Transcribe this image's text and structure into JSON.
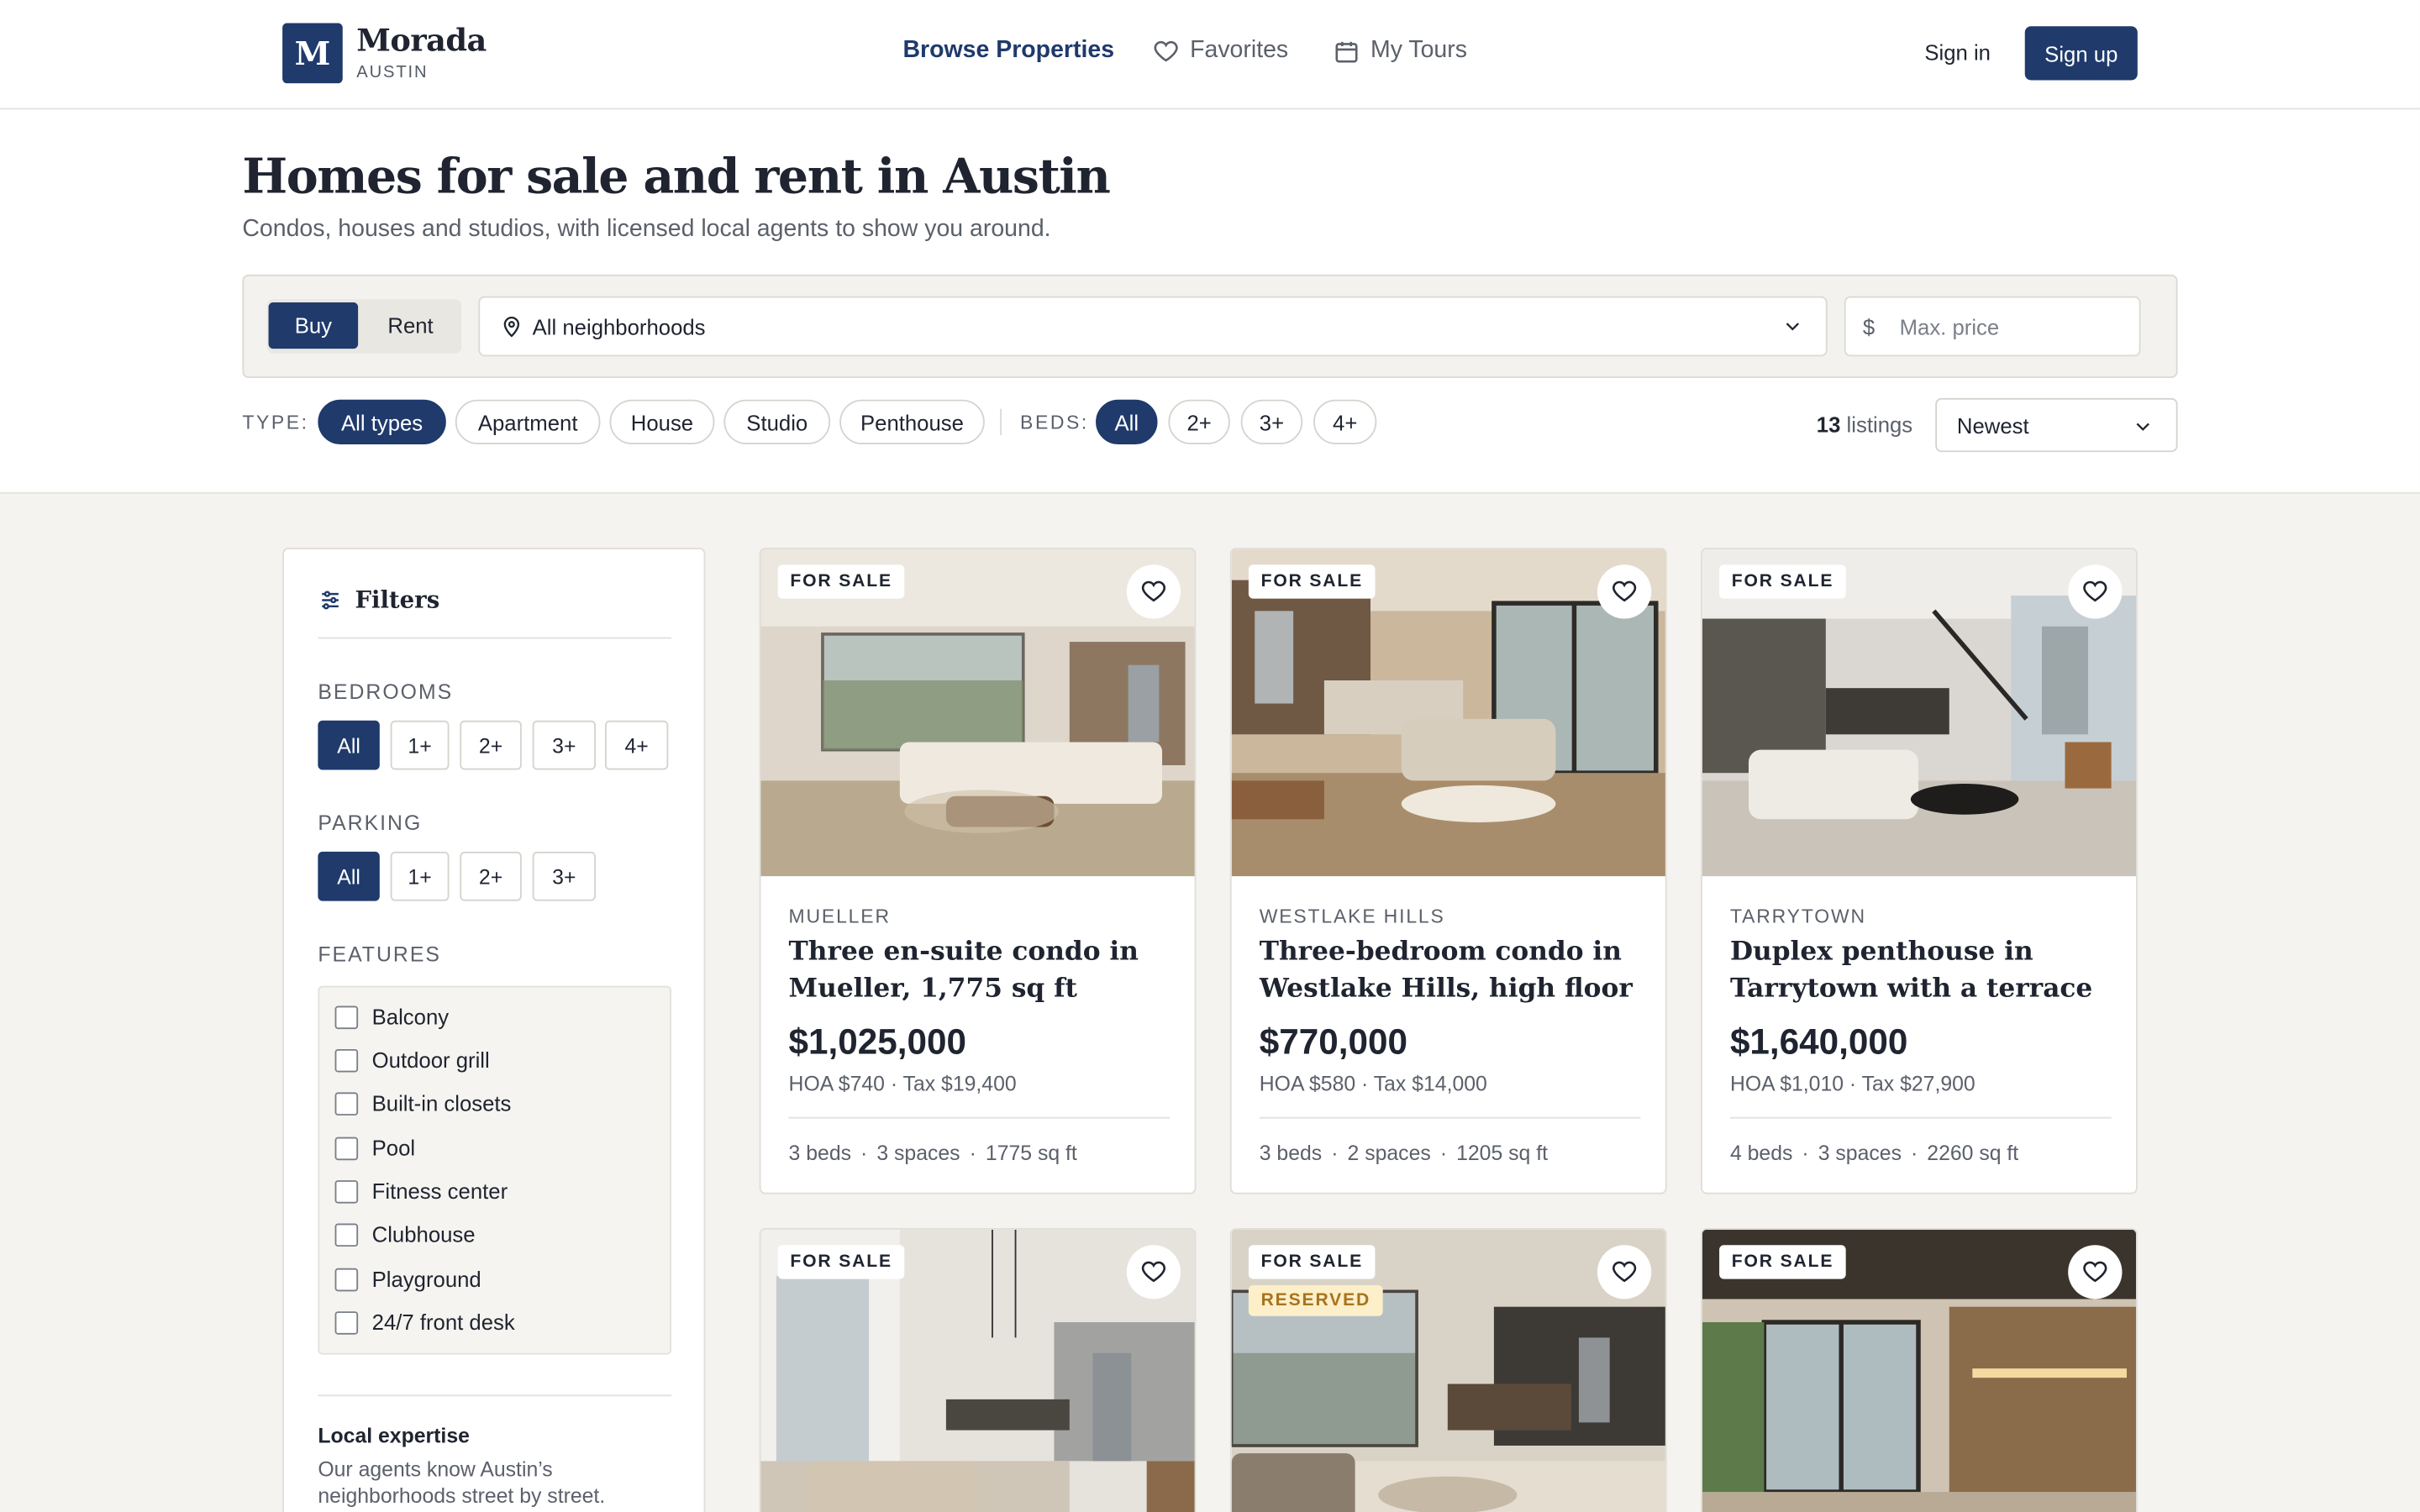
{
  "header": {
    "logo_letter": "M",
    "brand": "Morada",
    "brand_sub": "AUSTIN",
    "nav": {
      "browse": "Browse Properties",
      "favorites": "Favorites",
      "tours": "My Tours"
    },
    "sign_in": "Sign in",
    "sign_up": "Sign up"
  },
  "hero": {
    "title": "Homes for sale and rent in Austin",
    "subtitle": "Condos, houses and studios, with licensed local agents to show you around."
  },
  "search": {
    "mode_buy": "Buy",
    "mode_rent": "Rent",
    "mode_selected": "Buy",
    "neighborhood": "All neighborhoods",
    "price_symbol": "$",
    "price_placeholder": "Max. price"
  },
  "quick_filters": {
    "type_label": "TYPE:",
    "types": [
      "All types",
      "Apartment",
      "House",
      "Studio",
      "Penthouse"
    ],
    "type_selected": "All types",
    "beds_label": "BEDS:",
    "beds": [
      "All",
      "2+",
      "3+",
      "4+"
    ],
    "beds_selected": "All",
    "count": "13",
    "count_label": "listings",
    "sort": "Newest"
  },
  "sidebar": {
    "title": "Filters",
    "bedrooms_label": "BEDROOMS",
    "bedrooms": [
      "All",
      "1+",
      "2+",
      "3+",
      "4+"
    ],
    "parking_label": "PARKING",
    "parking": [
      "All",
      "1+",
      "2+",
      "3+"
    ],
    "features_label": "FEATURES",
    "features": [
      "Balcony",
      "Outdoor grill",
      "Built-in closets",
      "Pool",
      "Fitness center",
      "Clubhouse",
      "Playground",
      "24/7 front desk"
    ],
    "local_title": "Local expertise",
    "local_desc": "Our agents know Austin’s neighborhoods street by street."
  },
  "listings": [
    {
      "tag": "FOR SALE",
      "neighborhood": "MUELLER",
      "title": "Three en-suite condo in Mueller, 1,775 sq ft",
      "price": "$1,025,000",
      "meta": "HOA $740 · Tax $19,400",
      "beds": "3 beds",
      "spaces": "3 spaces",
      "area": "1775 sq ft"
    },
    {
      "tag": "FOR SALE",
      "neighborhood": "WESTLAKE HILLS",
      "title": "Three-bedroom condo in Westlake Hills, high floor",
      "price": "$770,000",
      "meta": "HOA $580 · Tax $14,000",
      "beds": "3 beds",
      "spaces": "2 spaces",
      "area": "1205 sq ft"
    },
    {
      "tag": "FOR SALE",
      "neighborhood": "TARRYTOWN",
      "title": "Duplex penthouse in Tarrytown with a terrace an...",
      "price": "$1,640,000",
      "meta": "HOA $1,010 · Tax $27,900",
      "beds": "4 beds",
      "spaces": "3 spaces",
      "area": "2260 sq ft"
    },
    {
      "tag": "FOR SALE"
    },
    {
      "tag": "FOR SALE",
      "badge": "RESERVED"
    },
    {
      "tag": "FOR SALE"
    }
  ],
  "colors": {
    "accent": "#1f3a6b",
    "background": "#f5f3ef",
    "reserved": "#fcefc9"
  }
}
